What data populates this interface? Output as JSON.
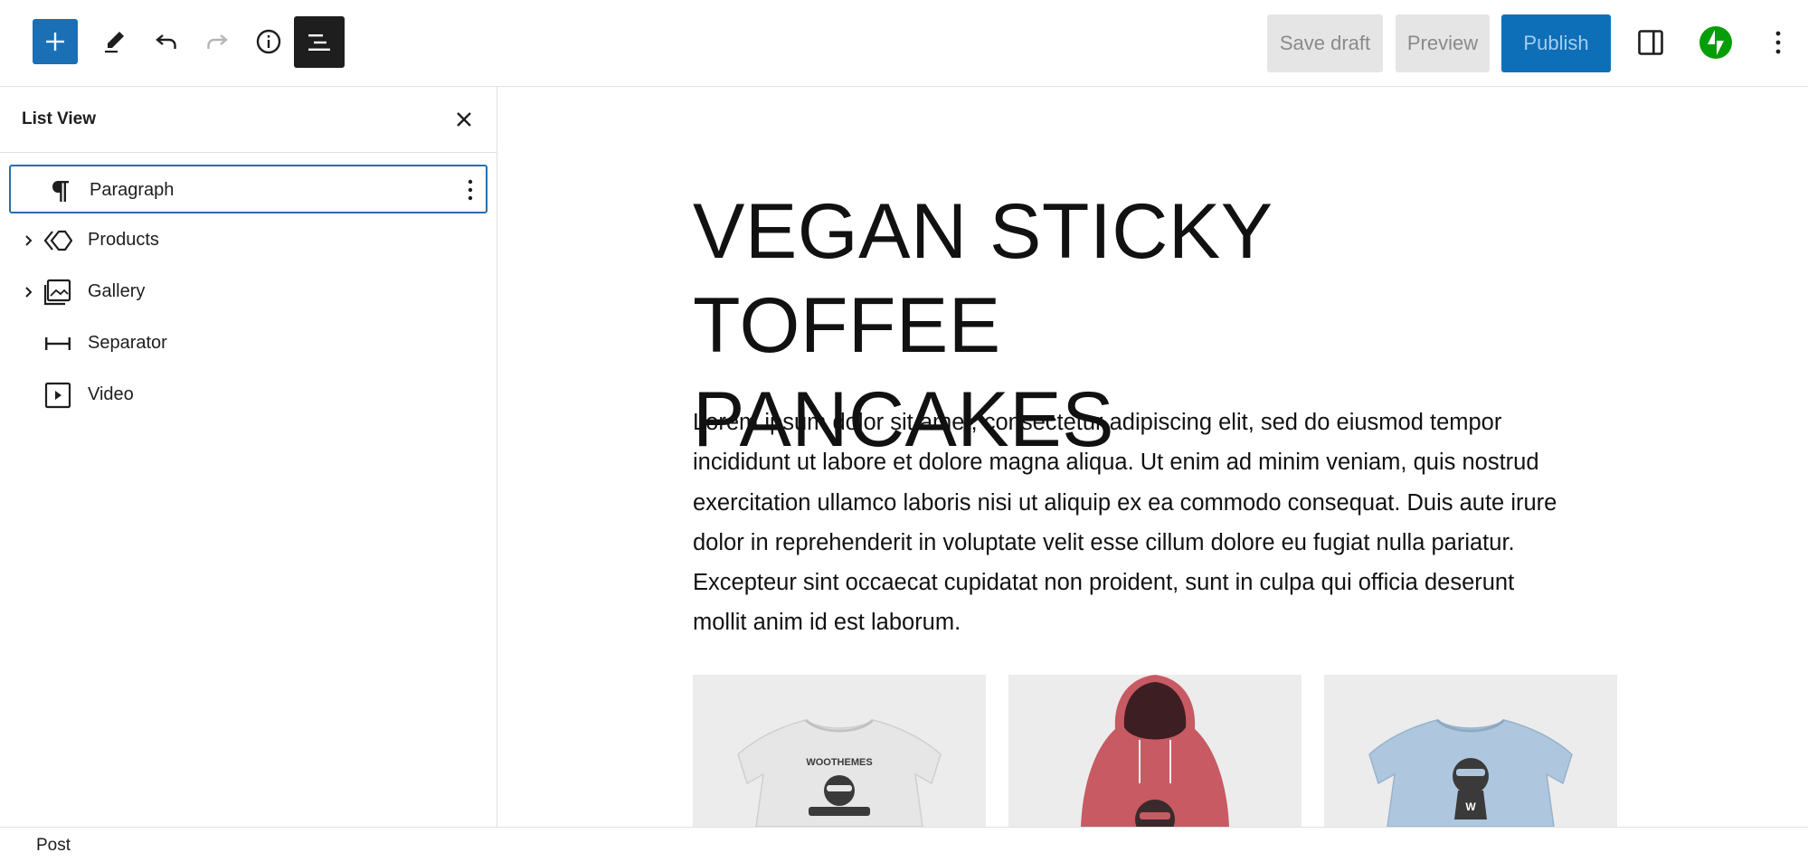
{
  "toolbar": {
    "add_block_icon": "plus-icon",
    "tools_icon": "pencil-icon",
    "undo_icon": "undo-icon",
    "redo_icon": "redo-icon",
    "details_icon": "info-icon",
    "list_view_icon": "list-view-icon",
    "save_draft_label": "Save draft",
    "preview_label": "Preview",
    "publish_label": "Publish",
    "settings_icon": "sidebar-toggle-icon",
    "jetpack_icon": "jetpack-bolt-icon",
    "options_icon": "vertical-ellipsis-icon",
    "accent_color": "#1b6fb5",
    "jetpack_color": "#069e08"
  },
  "list_view": {
    "title": "List View",
    "close_icon": "close-icon",
    "items": [
      {
        "label": "Paragraph",
        "icon": "paragraph-icon",
        "expandable": false,
        "selected": true
      },
      {
        "label": "Products",
        "icon": "products-icon",
        "expandable": true,
        "selected": false
      },
      {
        "label": "Gallery",
        "icon": "gallery-icon",
        "expandable": true,
        "selected": false
      },
      {
        "label": "Separator",
        "icon": "separator-icon",
        "expandable": false,
        "selected": false
      },
      {
        "label": "Video",
        "icon": "video-icon",
        "expandable": false,
        "selected": false
      }
    ]
  },
  "post": {
    "title_line1": "VEGAN STICKY TOFFEE",
    "title_line2": "PANCAKES",
    "body_lines": [
      "Lorem ipsum dolor sit amet, consectetur adipiscing elit, sed do eiusmod tempor",
      "incididunt ut labore et dolore magna aliqua. Ut enim ad minim veniam, quis nostrud",
      "exercitation ullamco laboris nisi ut aliquip ex ea commodo consequat. Duis aute irure",
      "dolor in reprehenderit in voluptate velit esse cillum dolore eu fugiat nulla pariatur.",
      "Excepteur sint occaecat cupidatat non proident, sunt in culpa qui officia deserunt",
      "mollit anim id est laborum."
    ],
    "gallery": [
      {
        "name": "white-tshirt",
        "color": "#e6e6e6",
        "print_text": "WOOTHEMES"
      },
      {
        "name": "red-hoodie",
        "color": "#c85a63",
        "print_text": ""
      },
      {
        "name": "blue-tshirt",
        "color": "#aec7de",
        "print_text": "W"
      }
    ]
  },
  "footer": {
    "breadcrumb": "Post"
  }
}
